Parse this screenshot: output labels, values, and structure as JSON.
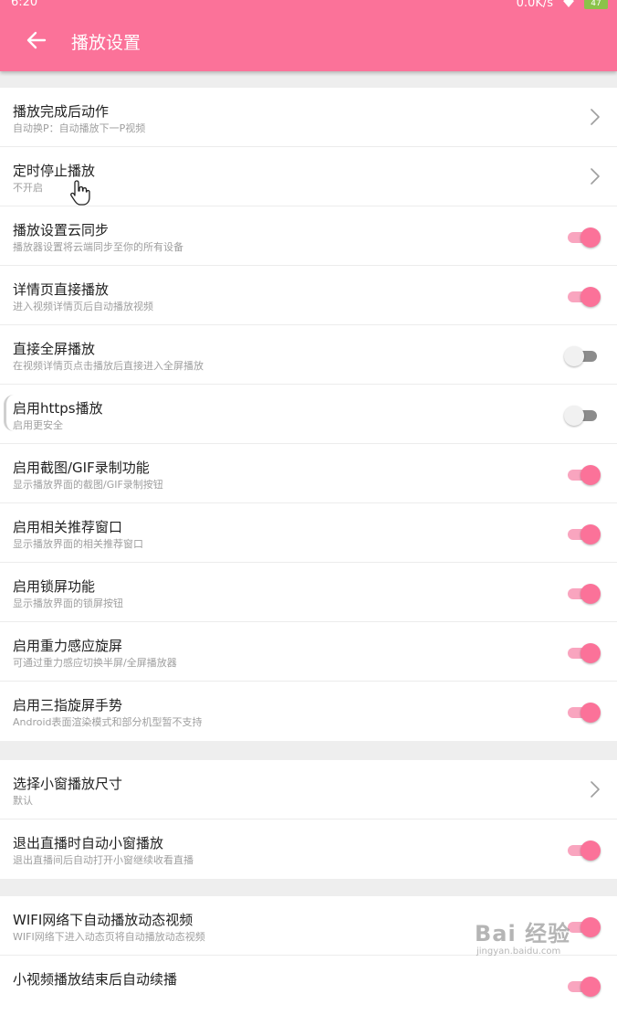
{
  "status_bar": {
    "time": "6:20",
    "speed": "0.0K/s",
    "battery": "47"
  },
  "header": {
    "title": "播放设置",
    "back_icon": "arrow-left-icon",
    "bg_color": "#fb7299"
  },
  "sections": [
    {
      "items": [
        {
          "title": "播放完成后动作",
          "subtitle": "自动换P：自动播放下一P视频",
          "control": "chevron"
        },
        {
          "title": "定时停止播放",
          "subtitle": "不开启",
          "control": "chevron"
        },
        {
          "title": "播放设置云同步",
          "subtitle": "播放器设置将云端同步至你的所有设备",
          "control": "switch",
          "on": true
        },
        {
          "title": "详情页直接播放",
          "subtitle": "进入视频详情页后自动播放视频",
          "control": "switch",
          "on": true
        },
        {
          "title": "直接全屏播放",
          "subtitle": "在视频详情页点击播放后直接进入全屏播放",
          "control": "switch",
          "on": false
        },
        {
          "title": "启用https播放",
          "subtitle": "启用更安全",
          "control": "switch",
          "on": false
        },
        {
          "title": "启用截图/GIF录制功能",
          "subtitle": "显示播放界面的截图/GIF录制按钮",
          "control": "switch",
          "on": true
        },
        {
          "title": "启用相关推荐窗口",
          "subtitle": "显示播放界面的相关推荐窗口",
          "control": "switch",
          "on": true
        },
        {
          "title": "启用锁屏功能",
          "subtitle": "显示播放界面的锁屏按钮",
          "control": "switch",
          "on": true
        },
        {
          "title": "启用重力感应旋屏",
          "subtitle": "可通过重力感应切换半屏/全屏播放器",
          "control": "switch",
          "on": true
        },
        {
          "title": "启用三指旋屏手势",
          "subtitle": "Android表面渲染模式和部分机型暂不支持",
          "control": "switch",
          "on": true
        }
      ]
    },
    {
      "items": [
        {
          "title": "选择小窗播放尺寸",
          "subtitle": "默认",
          "control": "chevron"
        },
        {
          "title": "退出直播时自动小窗播放",
          "subtitle": "退出直播间后自动打开小窗继续收看直播",
          "control": "switch",
          "on": true
        }
      ]
    },
    {
      "items": [
        {
          "title": "WIFI网络下自动播放动态视频",
          "subtitle": "WIFI网络下进入动态页将自动播放动态视频",
          "control": "switch",
          "on": true
        },
        {
          "title": "小视频播放结束后自动续播",
          "subtitle": "",
          "control": "switch",
          "on": true
        }
      ]
    }
  ],
  "watermark": {
    "main": "Bai 经验",
    "sub": "jingyan.baidu.com"
  },
  "colors": {
    "accent": "#fb7299",
    "switch_track_on": "#f9a5bf",
    "switch_track_off": "#8c8c8c"
  }
}
